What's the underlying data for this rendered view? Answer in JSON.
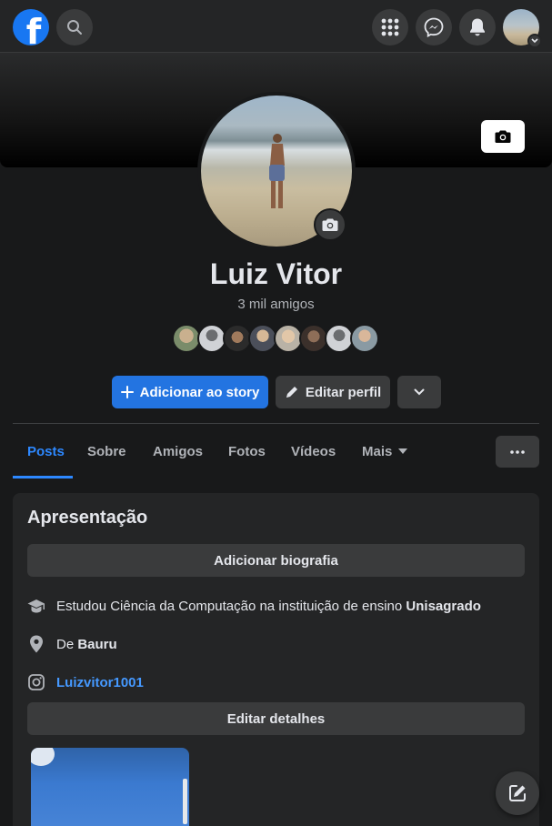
{
  "header": {
    "logo_letter": "f",
    "icons": [
      "search-icon",
      "menu-grid-icon",
      "messenger-icon",
      "notifications-icon"
    ]
  },
  "profile": {
    "name": "Luiz Vitor",
    "friends_count": "3 mil amigos",
    "friend_avatar_count": 8
  },
  "actions": {
    "add_story": "Adicionar ao story",
    "edit_profile": "Editar perfil"
  },
  "tabs": [
    {
      "label": "Posts",
      "active": true
    },
    {
      "label": "Sobre",
      "active": false
    },
    {
      "label": "Amigos",
      "active": false
    },
    {
      "label": "Fotos",
      "active": false
    },
    {
      "label": "Vídeos",
      "active": false
    },
    {
      "label": "Mais",
      "active": false
    }
  ],
  "intro": {
    "title": "Apresentação",
    "add_bio": "Adicionar biografia",
    "education_prefix": "Estudou Ciência da Computação na instituição de ensino ",
    "education_school": "Unisagrado",
    "hometown_prefix": "De ",
    "hometown": "Bauru",
    "instagram": "Luizvitor1001",
    "edit_details": "Editar detalhes"
  },
  "colors": {
    "background": "#18191a",
    "surface": "#242526",
    "button": "#3a3b3c",
    "primary": "#2374e1",
    "link": "#4599ff",
    "brand": "#1877f2"
  }
}
